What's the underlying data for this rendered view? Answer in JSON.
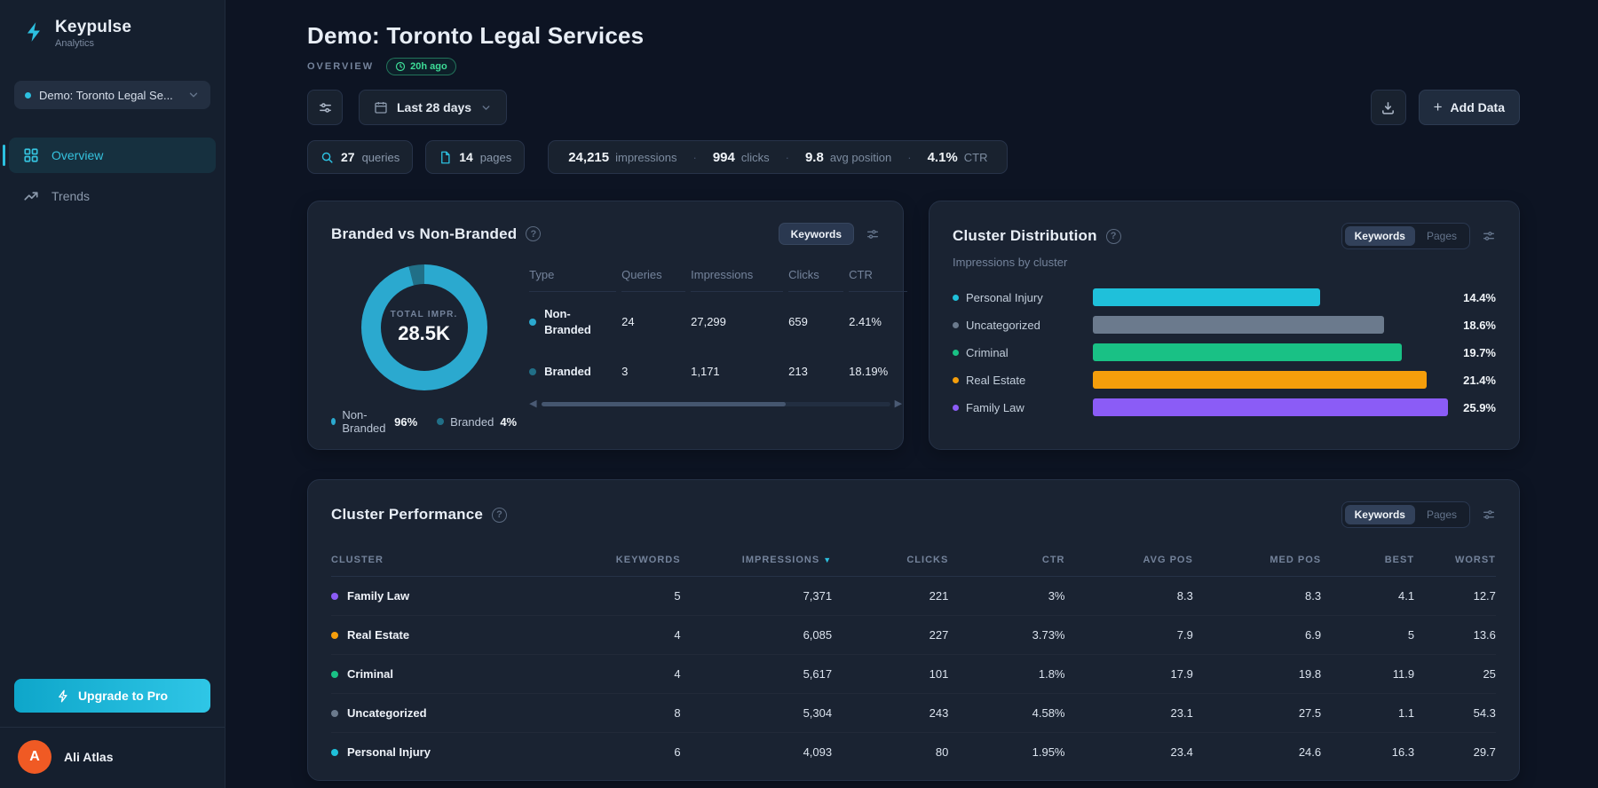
{
  "colors": {
    "accent_cyan": "#2cc0e0",
    "non_branded": "#2ba9cf",
    "branded": "#216f87",
    "personal_injury": "#1fc0da",
    "uncategorized": "#6b7a8d",
    "criminal": "#19c185",
    "real_estate": "#f59e0b",
    "family_law": "#8b5cf6",
    "badge_green": "#3ddc97",
    "avatar_orange": "#f05a24"
  },
  "sidebar": {
    "brand": {
      "name": "Keypulse",
      "subtitle": "Analytics"
    },
    "project_selector": {
      "label": "Demo: Toronto Legal Se..."
    },
    "nav": [
      {
        "label": "Overview",
        "active": true
      },
      {
        "label": "Trends",
        "active": false
      }
    ],
    "upgrade_label": "Upgrade to Pro",
    "user": {
      "initial": "A",
      "name": "Ali Atlas"
    }
  },
  "header": {
    "title": "Demo: Toronto Legal Services",
    "section_label": "OVERVIEW",
    "updated_badge": "20h ago",
    "date_range": "Last 28 days",
    "add_data_label": "Add Data"
  },
  "stats": {
    "queries": {
      "value": "27",
      "label": "queries"
    },
    "pages": {
      "value": "14",
      "label": "pages"
    },
    "metrics": [
      {
        "value": "24,215",
        "label": "impressions"
      },
      {
        "value": "994",
        "label": "clicks"
      },
      {
        "value": "9.8",
        "label": "avg position"
      },
      {
        "value": "4.1%",
        "label": "CTR"
      }
    ]
  },
  "branded_card": {
    "title": "Branded vs Non-Branded",
    "toggle_label": "Keywords",
    "donut": {
      "center_label": "TOTAL IMPR.",
      "center_value": "28.5K",
      "segments": [
        {
          "name": "Non-Branded",
          "pct": 96,
          "color": "#2ba9cf"
        },
        {
          "name": "Branded",
          "pct": 4,
          "color": "#216f87"
        }
      ]
    },
    "legend": [
      {
        "name": "Non-Branded",
        "pct": "96%",
        "color": "#2ba9cf"
      },
      {
        "name": "Branded",
        "pct": "4%",
        "color": "#216f87"
      }
    ],
    "table": {
      "headers": {
        "type": "Type",
        "queries": "Queries",
        "impressions": "Impressions",
        "clicks": "Clicks",
        "ctr": "CTR"
      },
      "rows": [
        {
          "type": "Non-Branded",
          "queries": "24",
          "impressions": "27,299",
          "clicks": "659",
          "ctr": "2.41%",
          "color": "#2ba9cf"
        },
        {
          "type": "Branded",
          "queries": "3",
          "impressions": "1,171",
          "clicks": "213",
          "ctr": "18.19%",
          "color": "#216f87"
        }
      ]
    }
  },
  "cluster_distribution": {
    "title": "Cluster Distribution",
    "subtitle": "Impressions by cluster",
    "toggle": {
      "active": "Keywords",
      "inactive": "Pages"
    },
    "bars": [
      {
        "label": "Personal Injury",
        "value": "14.4%",
        "color": "#1fc0da",
        "width": "64%"
      },
      {
        "label": "Uncategorized",
        "value": "18.6%",
        "color": "#6b7a8d",
        "width": "82%"
      },
      {
        "label": "Criminal",
        "value": "19.7%",
        "color": "#19c185",
        "width": "87%"
      },
      {
        "label": "Real Estate",
        "value": "21.4%",
        "color": "#f59e0b",
        "width": "94%"
      },
      {
        "label": "Family Law",
        "value": "25.9%",
        "color": "#8b5cf6",
        "width": "100%"
      }
    ]
  },
  "cluster_performance": {
    "title": "Cluster Performance",
    "toggle": {
      "active": "Keywords",
      "inactive": "Pages"
    },
    "headers": {
      "cluster": "CLUSTER",
      "keywords": "KEYWORDS",
      "impressions": "IMPRESSIONS",
      "clicks": "CLICKS",
      "ctr": "CTR",
      "avg_pos": "AVG POS",
      "med_pos": "MED POS",
      "best": "BEST",
      "worst": "WORST"
    },
    "sorted_by": "IMPRESSIONS",
    "rows": [
      {
        "cluster": "Family Law",
        "color": "#8b5cf6",
        "keywords": "5",
        "impressions": "7,371",
        "clicks": "221",
        "ctr": "3%",
        "avg_pos": "8.3",
        "med_pos": "8.3",
        "best": "4.1",
        "worst": "12.7"
      },
      {
        "cluster": "Real Estate",
        "color": "#f59e0b",
        "keywords": "4",
        "impressions": "6,085",
        "clicks": "227",
        "ctr": "3.73%",
        "avg_pos": "7.9",
        "med_pos": "6.9",
        "best": "5",
        "worst": "13.6"
      },
      {
        "cluster": "Criminal",
        "color": "#19c185",
        "keywords": "4",
        "impressions": "5,617",
        "clicks": "101",
        "ctr": "1.8%",
        "avg_pos": "17.9",
        "med_pos": "19.8",
        "best": "11.9",
        "worst": "25"
      },
      {
        "cluster": "Uncategorized",
        "color": "#6b7a8d",
        "keywords": "8",
        "impressions": "5,304",
        "clicks": "243",
        "ctr": "4.58%",
        "avg_pos": "23.1",
        "med_pos": "27.5",
        "best": "1.1",
        "worst": "54.3"
      },
      {
        "cluster": "Personal Injury",
        "color": "#1fc0da",
        "keywords": "6",
        "impressions": "4,093",
        "clicks": "80",
        "ctr": "1.95%",
        "avg_pos": "23.4",
        "med_pos": "24.6",
        "best": "16.3",
        "worst": "29.7"
      }
    ]
  },
  "chart_data": [
    {
      "type": "pie",
      "title": "Branded vs Non-Branded",
      "categories": [
        "Non-Branded",
        "Branded"
      ],
      "values": [
        96,
        4
      ],
      "center_label": "TOTAL IMPR.",
      "center_value": "28.5K",
      "legend_position": "bottom"
    },
    {
      "type": "bar",
      "title": "Cluster Distribution",
      "subtitle": "Impressions by cluster",
      "orientation": "horizontal",
      "categories": [
        "Personal Injury",
        "Uncategorized",
        "Criminal",
        "Real Estate",
        "Family Law"
      ],
      "values": [
        14.4,
        18.6,
        19.7,
        21.4,
        25.9
      ],
      "unit": "%",
      "grid": false
    },
    {
      "type": "table",
      "title": "Cluster Performance",
      "columns": [
        "CLUSTER",
        "KEYWORDS",
        "IMPRESSIONS",
        "CLICKS",
        "CTR",
        "AVG POS",
        "MED POS",
        "BEST",
        "WORST"
      ],
      "rows": [
        [
          "Family Law",
          5,
          7371,
          221,
          "3%",
          8.3,
          8.3,
          4.1,
          12.7
        ],
        [
          "Real Estate",
          4,
          6085,
          227,
          "3.73%",
          7.9,
          6.9,
          5,
          13.6
        ],
        [
          "Criminal",
          4,
          5617,
          101,
          "1.8%",
          17.9,
          19.8,
          11.9,
          25
        ],
        [
          "Uncategorized",
          8,
          5304,
          243,
          "4.58%",
          23.1,
          27.5,
          1.1,
          54.3
        ],
        [
          "Personal Injury",
          6,
          4093,
          80,
          "1.95%",
          23.4,
          24.6,
          16.3,
          29.7
        ]
      ]
    }
  ]
}
